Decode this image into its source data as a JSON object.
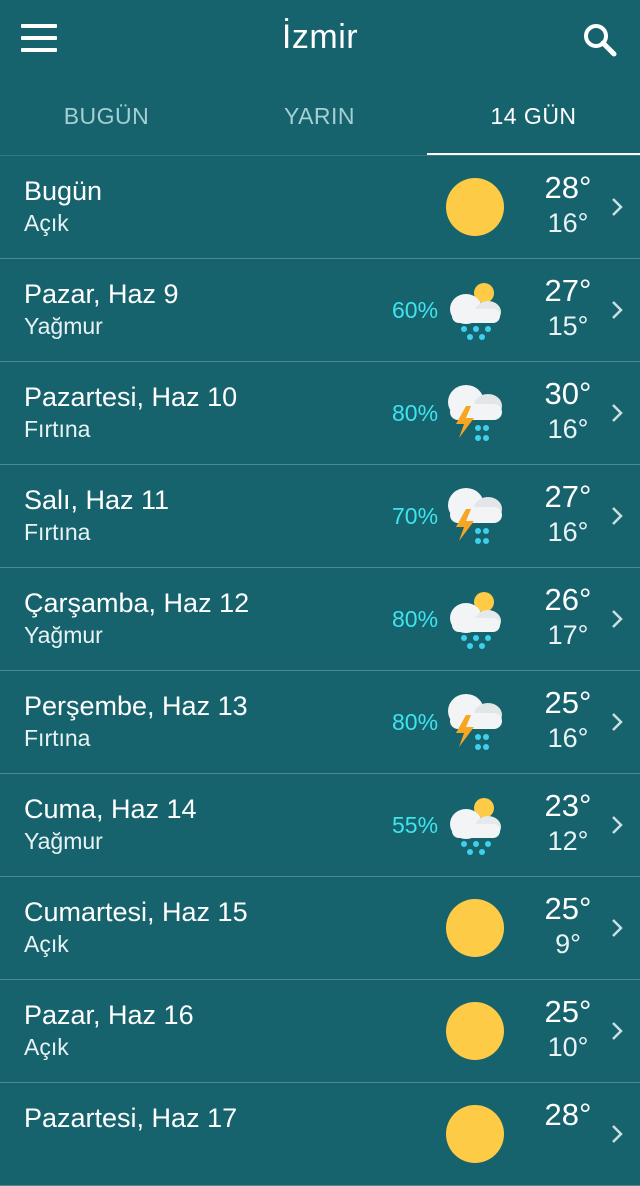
{
  "header": {
    "title": "İzmir",
    "menu_icon": "hamburger-menu-icon",
    "search_icon": "search-icon"
  },
  "tabs": [
    {
      "label": "BUGÜN",
      "active": false
    },
    {
      "label": "YARIN",
      "active": false
    },
    {
      "label": "14 GÜN",
      "active": true
    }
  ],
  "colors": {
    "background": "#16636e",
    "accent_precip": "#3fe3ee",
    "sun": "#fdcb45",
    "divider": "#4a8a92"
  },
  "forecast": [
    {
      "day": "Bugün",
      "condition": "Açık",
      "precip": "",
      "icon": "sun-icon",
      "high": "28°",
      "low": "16°"
    },
    {
      "day": "Pazar, Haz 9",
      "condition": "Yağmur",
      "precip": "60%",
      "icon": "rain-icon",
      "high": "27°",
      "low": "15°"
    },
    {
      "day": "Pazartesi, Haz 10",
      "condition": "Fırtına",
      "precip": "80%",
      "icon": "storm-icon",
      "high": "30°",
      "low": "16°"
    },
    {
      "day": "Salı, Haz 11",
      "condition": "Fırtına",
      "precip": "70%",
      "icon": "storm-icon",
      "high": "27°",
      "low": "16°"
    },
    {
      "day": "Çarşamba, Haz 12",
      "condition": "Yağmur",
      "precip": "80%",
      "icon": "rain-icon",
      "high": "26°",
      "low": "17°"
    },
    {
      "day": "Perşembe, Haz 13",
      "condition": "Fırtına",
      "precip": "80%",
      "icon": "storm-icon",
      "high": "25°",
      "low": "16°"
    },
    {
      "day": "Cuma, Haz 14",
      "condition": "Yağmur",
      "precip": "55%",
      "icon": "rain-icon",
      "high": "23°",
      "low": "12°"
    },
    {
      "day": "Cumartesi, Haz 15",
      "condition": "Açık",
      "precip": "",
      "icon": "sun-icon",
      "high": "25°",
      "low": "9°"
    },
    {
      "day": "Pazar, Haz 16",
      "condition": "Açık",
      "precip": "",
      "icon": "sun-icon",
      "high": "25°",
      "low": "10°"
    },
    {
      "day": "Pazartesi, Haz 17",
      "condition": "",
      "precip": "",
      "icon": "sun-icon",
      "high": "28°",
      "low": ""
    }
  ]
}
